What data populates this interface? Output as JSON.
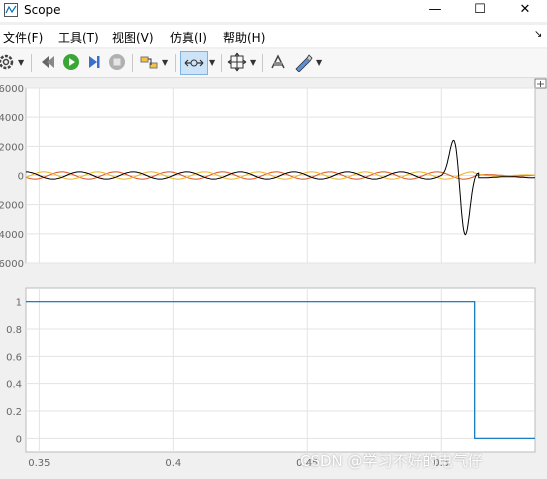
{
  "window": {
    "title": "Scope",
    "minimize_glyph": "—",
    "maximize_glyph": "☐",
    "close_glyph": "✕"
  },
  "menu": {
    "items": [
      "文件(F)",
      "工具(T)",
      "视图(V)",
      "仿真(I)",
      "帮助(H)"
    ],
    "corner_glyph": "↘"
  },
  "toolbar": {
    "icons": [
      "settings-icon",
      "rewind-step-icon",
      "run-icon",
      "step-forward-icon",
      "stop-icon",
      "signal-selector-icon",
      "zoom-icon",
      "autoscale-icon",
      "highlight-block-icon",
      "style-icon"
    ]
  },
  "colors": {
    "series_black": "#000000",
    "series_orange": "#d95319",
    "series_yellow": "#edb120",
    "series_blue": "#0072bd"
  },
  "chart_data": [
    {
      "type": "line",
      "ylim": [
        -6000,
        6000
      ],
      "yticks": [
        "6000",
        "4000",
        "2000",
        "0",
        "2000",
        "4000",
        "6000"
      ],
      "xlim": [
        0.345,
        0.535
      ],
      "grid": true,
      "series": [
        {
          "color": "black",
          "description": "sinusoid amplitude ~250 until 0.5, transient burst peaking near 5000 / -5000 at ~0.505-0.51, then ~0"
        },
        {
          "color": "orange",
          "description": "sinusoid amplitude ~250 phase-shifted, collapses after ~0.512"
        },
        {
          "color": "yellow",
          "description": "sinusoid amplitude ~250 phase-shifted, collapses after ~0.512"
        }
      ]
    },
    {
      "type": "line",
      "xlim": [
        0.345,
        0.535
      ],
      "ylim": [
        -0.1,
        1.1
      ],
      "yticks": [
        "1",
        "0.8",
        "0.6",
        "0.4",
        "0.2",
        "0"
      ],
      "xticks": [
        "0.35",
        "0.4",
        "0.45",
        "0.5"
      ],
      "grid": true,
      "series": [
        {
          "color": "blue",
          "x": [
            0.345,
            0.5125,
            0.5125,
            0.535
          ],
          "y": [
            1,
            1,
            0,
            0
          ]
        }
      ]
    }
  ],
  "watermark": "CSDN @学习不好的电气仔"
}
